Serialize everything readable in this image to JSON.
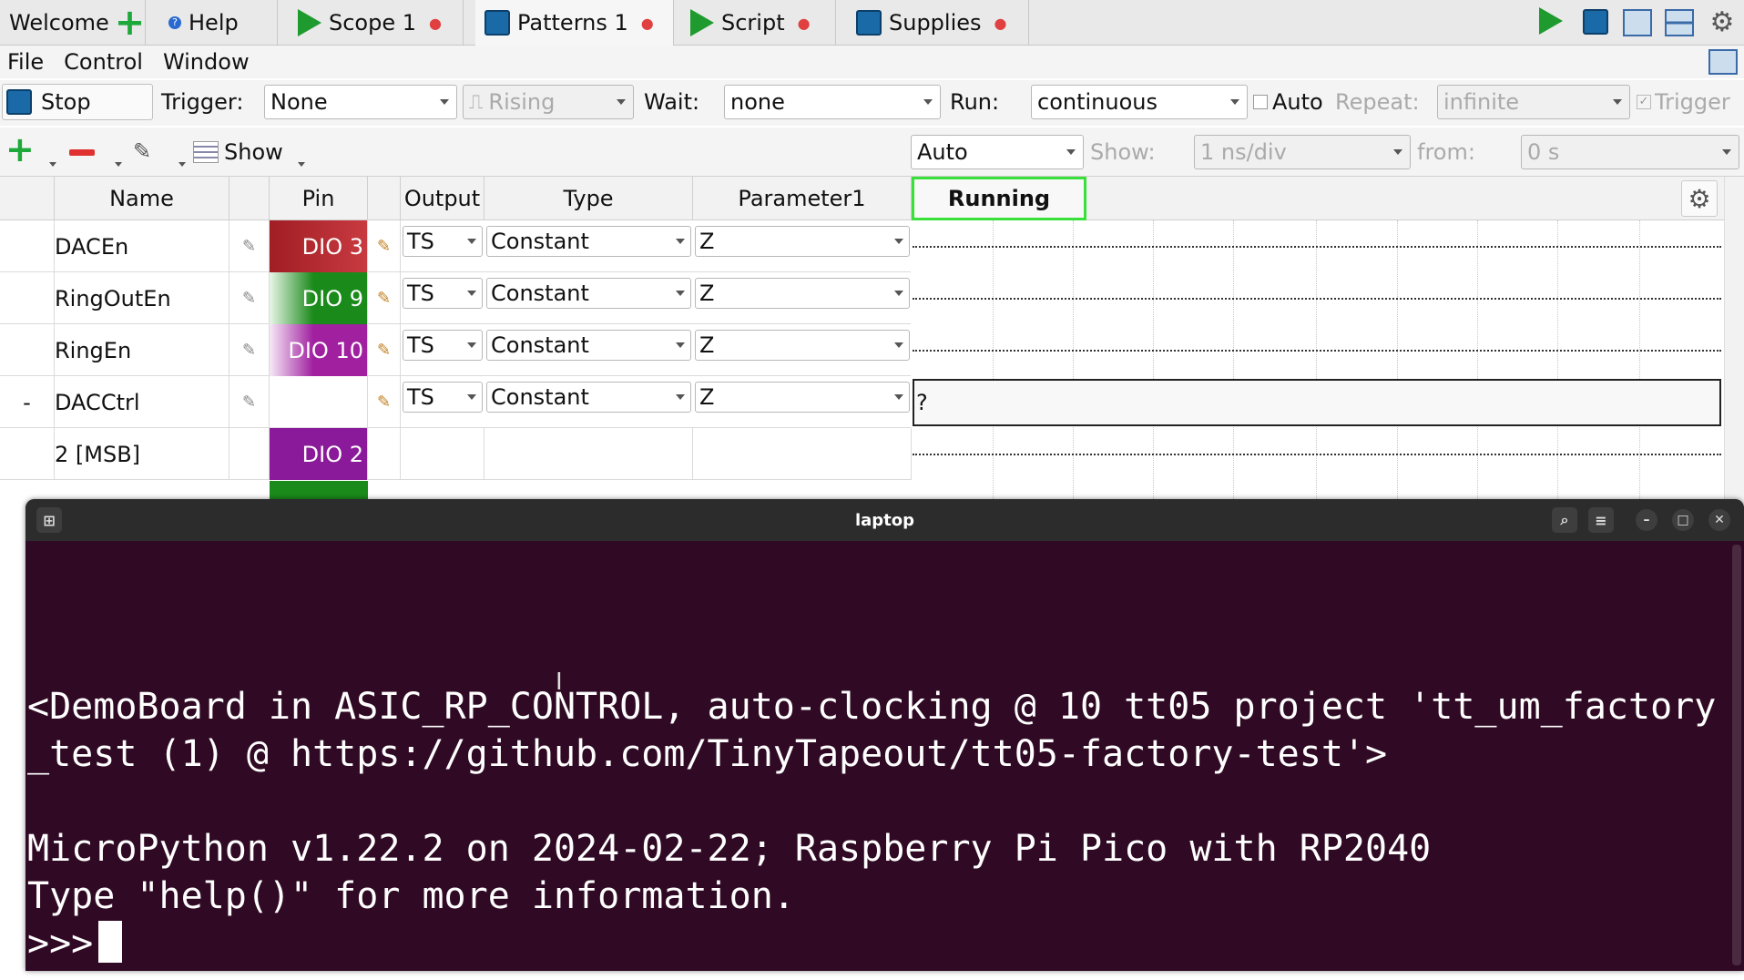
{
  "tabs": [
    {
      "label": "Welcome",
      "icon": "plus-icon"
    },
    {
      "label": "Help",
      "icon": "help-icon"
    },
    {
      "label": "Scope 1",
      "icon": "play-icon"
    },
    {
      "label": "Patterns 1",
      "icon": "stop-square-icon"
    },
    {
      "label": "Script",
      "icon": "play-icon"
    },
    {
      "label": "Supplies",
      "icon": "stop-square-icon"
    }
  ],
  "menu": [
    "File",
    "Control",
    "Window"
  ],
  "toolbar": {
    "stop_label": "Stop",
    "trigger_label": "Trigger:",
    "trigger_value": "None",
    "edge_value": "Rising",
    "wait_label": "Wait:",
    "wait_value": "none",
    "run_label": "Run:",
    "run_value": "continuous",
    "auto_label": "Auto",
    "repeat_label": "Repeat:",
    "repeat_value": "infinite",
    "trigger_check_label": "Trigger"
  },
  "toolbar2": {
    "show_label": "Show",
    "zoom_value": "Auto",
    "show_field_label": "Show:",
    "show_value": "1 ns/div",
    "from_label": "from:",
    "from_value": "0 s"
  },
  "columns": {
    "name": "Name",
    "pin": "Pin",
    "output": "Output",
    "type": "Type",
    "param": "Parameter1"
  },
  "status": "Running",
  "rows": [
    {
      "prefix": "",
      "name": "DACEn",
      "pin": "DIO 3",
      "pin_color": "#b0242c",
      "output": "TS",
      "type": "Constant",
      "param": "Z"
    },
    {
      "prefix": "",
      "name": "RingOutEn",
      "pin": "DIO 9",
      "pin_color": "#1a8a1a",
      "output": "TS",
      "type": "Constant",
      "param": "Z"
    },
    {
      "prefix": "",
      "name": "RingEn",
      "pin": "DIO 10",
      "pin_color": "#a020a0",
      "output": "TS",
      "type": "Constant",
      "param": "Z"
    },
    {
      "prefix": "-",
      "name": "DACCtrl",
      "pin": "",
      "pin_color": "",
      "output": "TS",
      "type": "Constant",
      "param": "Z",
      "wave_text": "?"
    },
    {
      "prefix": "",
      "name": "2 [MSB]",
      "pin": "DIO 2",
      "pin_color": "#8a1a9a",
      "output": "",
      "type": "",
      "param": ""
    }
  ],
  "terminal": {
    "title": "laptop",
    "line1": "<DemoBoard in ASIC_RP_CONTROL, auto-clocking @ 10 tt05 project 'tt_um_factory_test (1) @ https://github.com/TinyTapeout/tt05-factory-test'>",
    "line2": "MicroPython v1.22.2 on 2024-02-22; Raspberry Pi Pico with RP2040",
    "line3": "Type \"help()\" for more information.",
    "prompt": ">>>"
  }
}
